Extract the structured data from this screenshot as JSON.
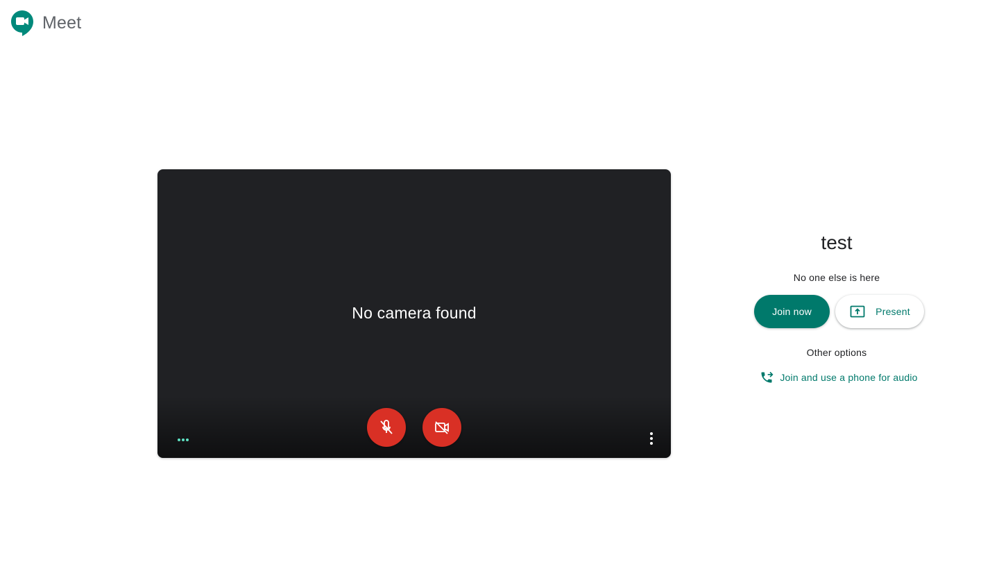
{
  "header": {
    "title": "Meet",
    "logo_icon": "google-meet-logo-icon"
  },
  "preview": {
    "message": "No camera found",
    "mic_button": {
      "icon": "mic-off-icon",
      "state": "muted",
      "color": "#d93025"
    },
    "camera_button": {
      "icon": "videocam-off-icon",
      "state": "off",
      "color": "#d93025"
    },
    "audio_indicator_icon": "audio-level-dots-icon",
    "more_options_icon": "more-vert-icon"
  },
  "meeting": {
    "name": "test",
    "status": "No one else is here",
    "join_label": "Join now",
    "present_label": "Present",
    "present_icon": "present-to-all-icon",
    "other_options_label": "Other options",
    "phone_audio_label": "Join and use a phone for audio",
    "phone_icon": "phone-forwarded-icon"
  },
  "colors": {
    "accent": "#00796b",
    "danger": "#d93025",
    "preview_bg": "#202124"
  }
}
